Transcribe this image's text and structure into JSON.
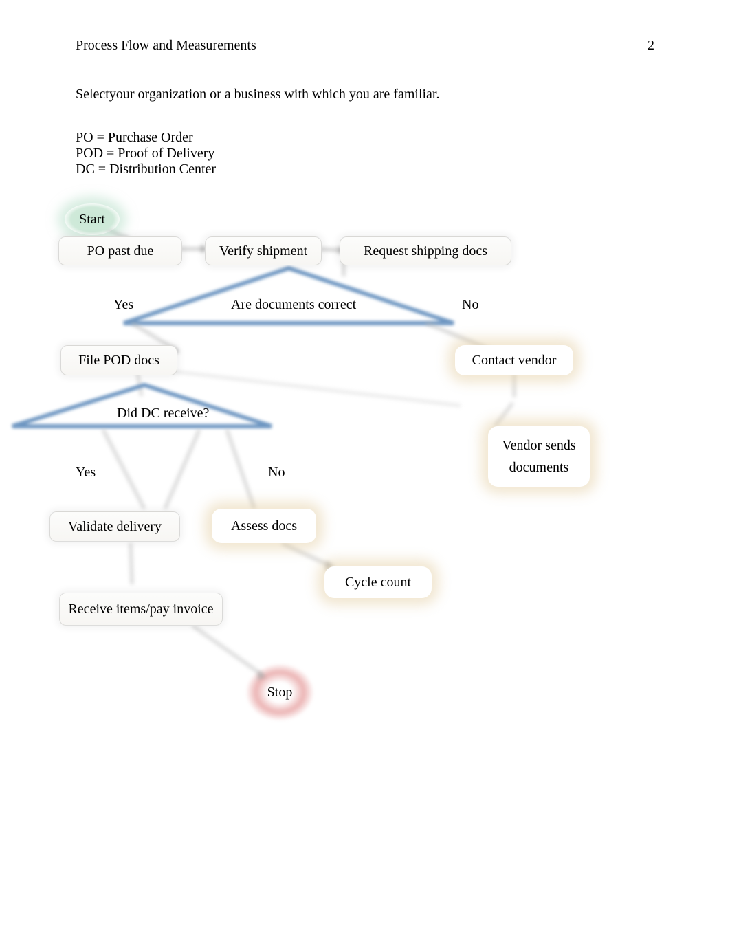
{
  "header": {
    "title": "Process Flow and Measurements",
    "page_number": "2"
  },
  "intro": "Selectyour organization or a business with which you are familiar.",
  "glossary": [
    "PO = Purchase Order",
    "POD = Proof of Delivery",
    "DC = Distribution Center"
  ],
  "diagram": {
    "start": "Start",
    "stop": "Stop",
    "po_past_due": "PO past due",
    "verify_shipment": "Verify shipment",
    "request_shipping_docs": "Request shipping docs",
    "decision_docs_correct": "Are documents correct",
    "yes1": "Yes",
    "no1": "No",
    "file_pod": "File POD docs",
    "contact_vendor": "Contact vendor",
    "decision_dc_receive": "Did DC receive?",
    "vendor_sends_docs_l1": "Vendor sends",
    "vendor_sends_docs_l2": "documents",
    "yes2": "Yes",
    "no2": "No",
    "validate_delivery": "Validate delivery",
    "assess_docs": "Assess docs",
    "cycle_count": "Cycle count",
    "receive_pay": "Receive items/pay invoice"
  }
}
